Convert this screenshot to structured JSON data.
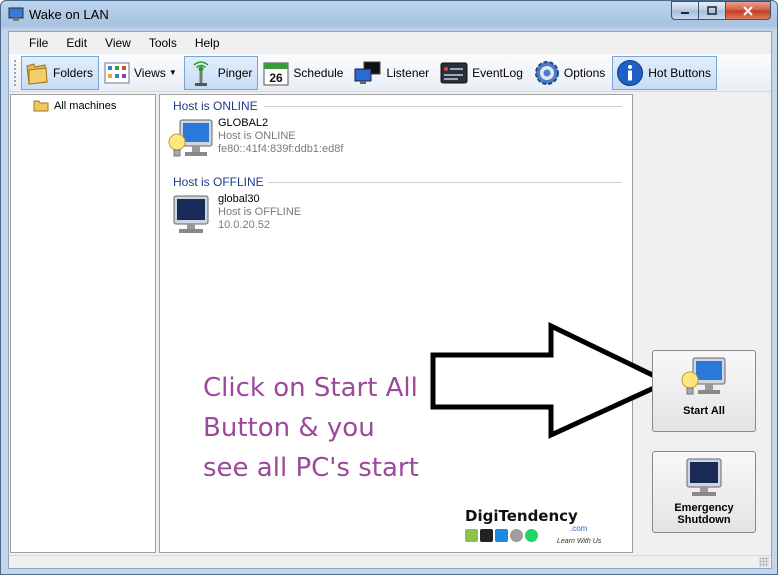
{
  "window": {
    "title": "Wake on LAN"
  },
  "menu": [
    "File",
    "Edit",
    "View",
    "Tools",
    "Help"
  ],
  "toolbar": {
    "folders": "Folders",
    "views": "Views",
    "pinger": "Pinger",
    "schedule": "Schedule",
    "schedule_day": "26",
    "listener": "Listener",
    "eventlog": "EventLog",
    "options": "Options",
    "hot_buttons": "Hot Buttons"
  },
  "tree": {
    "root": "All machines"
  },
  "groups": [
    {
      "header": "Host is ONLINE",
      "hosts": [
        {
          "name": "GLOBAL2",
          "status": "Host is ONLINE",
          "address": "fe80::41f4:839f:ddb1:ed8f"
        }
      ]
    },
    {
      "header": "Host is OFFLINE",
      "hosts": [
        {
          "name": "global30",
          "status": "Host is OFFLINE",
          "address": "10.0.20.52"
        }
      ]
    }
  ],
  "annotation": {
    "line1": "Click on Start All",
    "line2": "Button & you",
    "line3": "see all PC's start"
  },
  "brand": {
    "name": "DigiTendency",
    "com": ".com",
    "tagline": "Learn With Us"
  },
  "buttons": {
    "start_all": "Start  All",
    "emergency_line1": "Emergency",
    "emergency_line2": "Shutdown"
  },
  "colors": {
    "accent": "#7aa4d6",
    "annotation": "#9b4a9b",
    "group_header": "#1e3a8a"
  }
}
